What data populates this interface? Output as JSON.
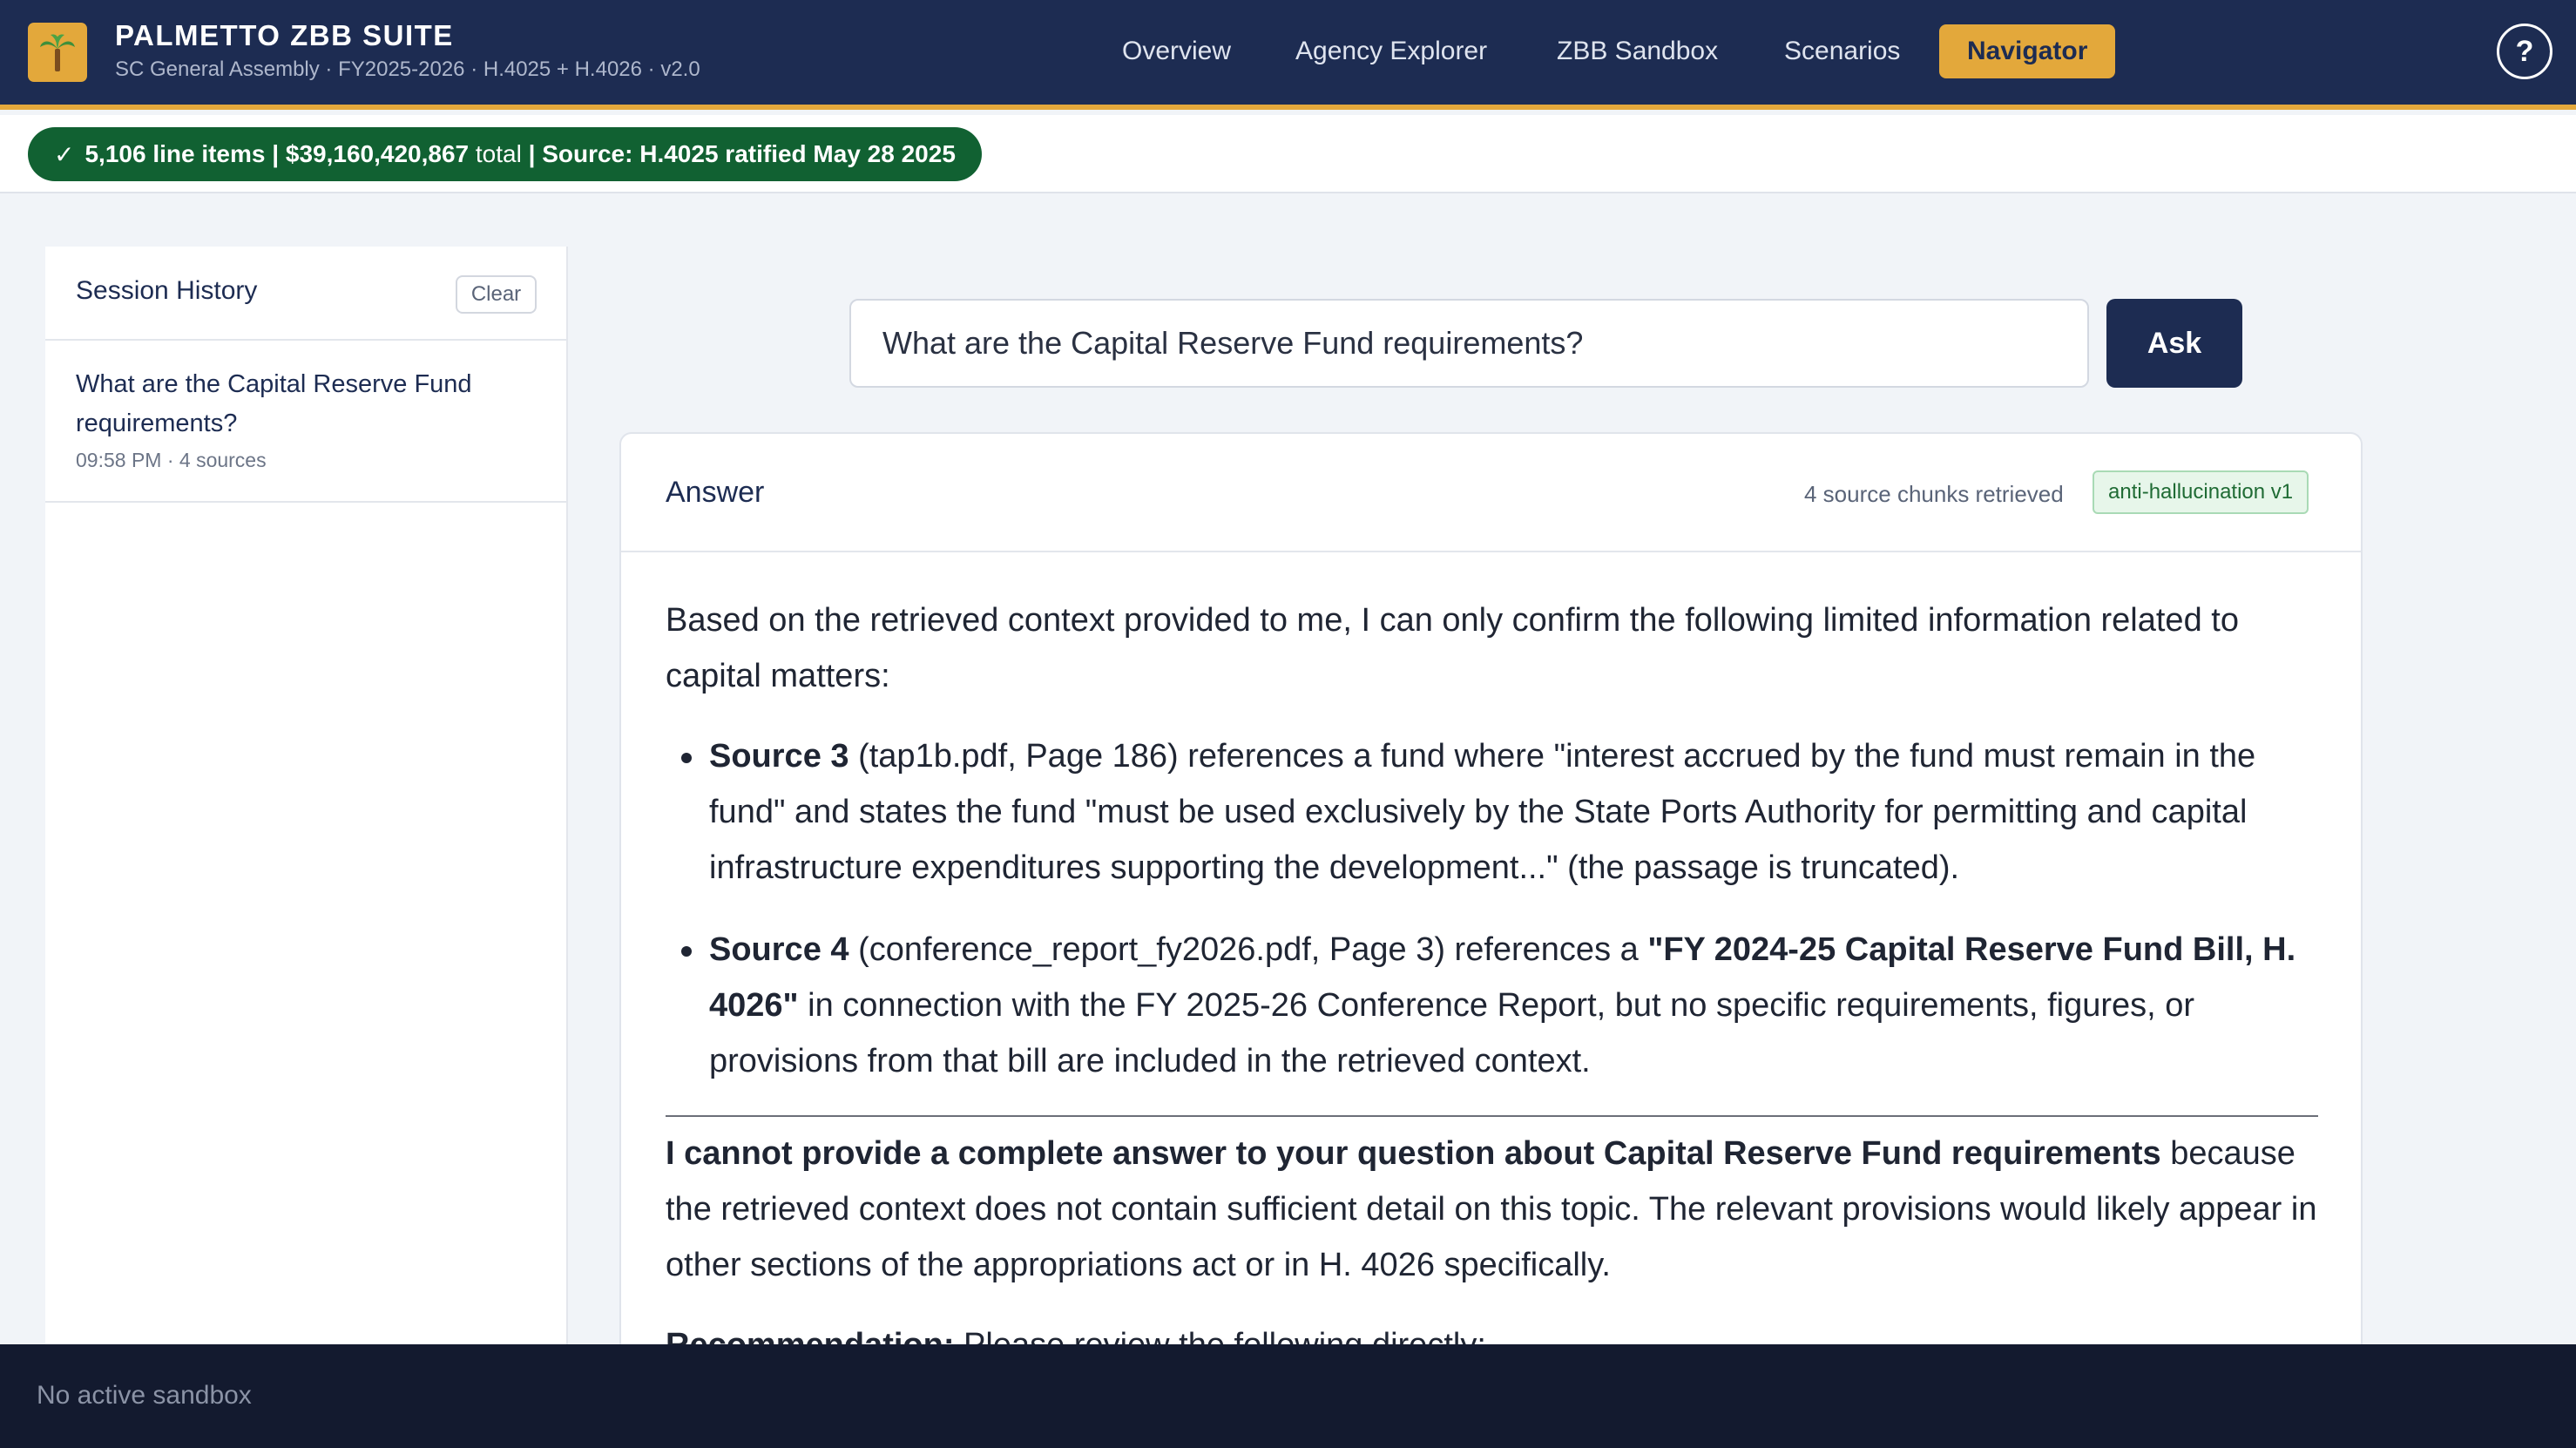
{
  "header": {
    "brand_title": "PALMETTO ZBB SUITE",
    "brand_subtitle": "SC General Assembly · FY2025-2026 · H.4025 + H.4026 · v2.0",
    "logo_icon": "palm-tree-icon",
    "nav": [
      {
        "label": "Overview",
        "active": false
      },
      {
        "label": "Agency Explorer",
        "active": false
      },
      {
        "label": "ZBB Sandbox",
        "active": false
      },
      {
        "label": "Scenarios",
        "active": false
      },
      {
        "label": "Navigator",
        "active": true
      }
    ],
    "help_label": "?"
  },
  "status": {
    "check": "✓",
    "line_items": "5,106 line items",
    "sep1": " | ",
    "total_amount": "$39,160,420,867",
    "total_word": " total",
    "source": " | Source: H.4025 ratified May 28 2025"
  },
  "sidebar": {
    "title": "Session History",
    "clear_label": "Clear",
    "history": [
      {
        "question": "What are the Capital Reserve Fund requirements?",
        "meta": "09:58 PM · 4 sources"
      }
    ]
  },
  "search": {
    "value": "What are the Capital Reserve Fund requirements?",
    "ask_label": "Ask"
  },
  "answer": {
    "title": "Answer",
    "chunks": "4 source chunks retrieved",
    "badge": "anti-hallucination v1",
    "intro": "Based on the retrieved context provided to me, I can only confirm the following limited information related to capital matters:",
    "bullet1_bold": "Source 3",
    "bullet1_text": " (tap1b.pdf, Page 186) references a fund where \"interest accrued by the fund must remain in the fund\" and states the fund \"must be used exclusively by the State Ports Authority for permitting and capital infrastructure expenditures supporting the development...\" (the passage is truncated).",
    "bullet2_bold": "Source 4",
    "bullet2_text_a": " (conference_report_fy2026.pdf, Page 3) references a ",
    "bullet2_bold2": "\"FY 2024-25 Capital Reserve Fund Bill, H. 4026\"",
    "bullet2_text_b": " in connection with the FY 2025-26 Conference Report, but no specific requirements, figures, or provisions from that bill are included in the retrieved context.",
    "cannot_bold": "I cannot provide a complete answer to your question about Capital Reserve Fund requirements",
    "cannot_text": " because the retrieved context does not contain sufficient detail on this topic. The relevant provisions would likely appear in other sections of the appropriations act or in H. 4026 specifically.",
    "rec_bold": "Recommendation:",
    "rec_text": " Please review the following directly:"
  },
  "footer": {
    "text": "No active sandbox"
  },
  "colors": {
    "navy": "#1d2c52",
    "gold": "#e3a83b",
    "green": "#116132",
    "footer": "#131a2f"
  }
}
